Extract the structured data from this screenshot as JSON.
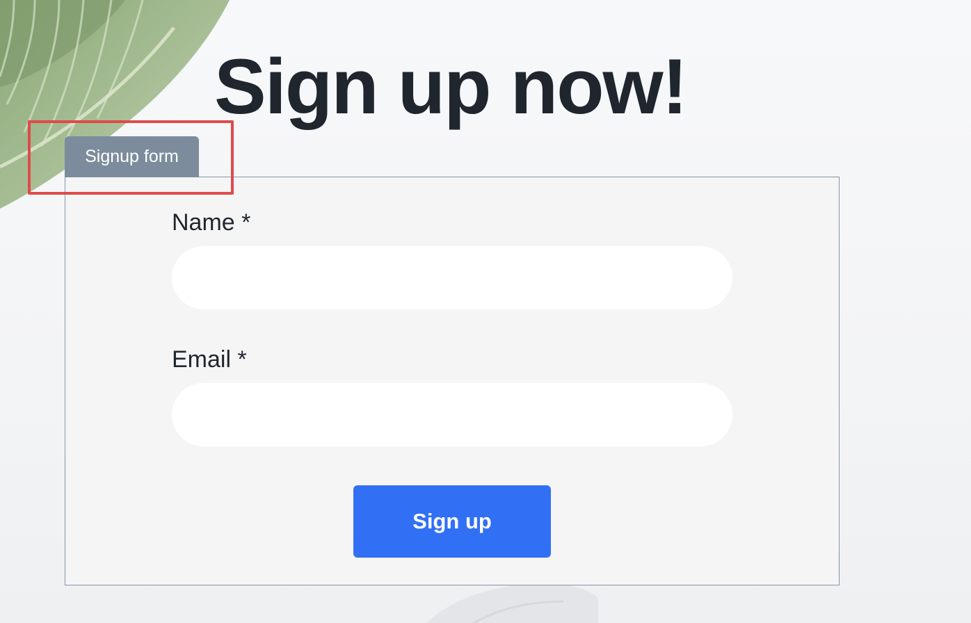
{
  "header": {
    "title": "Sign up now!"
  },
  "form": {
    "tab_label": "Signup form",
    "fields": [
      {
        "label": "Name *",
        "value": "",
        "placeholder": ""
      },
      {
        "label": "Email *",
        "value": "",
        "placeholder": ""
      }
    ],
    "submit_label": "Sign up"
  },
  "colors": {
    "title": "#1f262e",
    "tab_background": "#7c8c9c",
    "panel_background": "#f5f5f5",
    "panel_border": "#8594a8",
    "button_background": "#3170f5",
    "highlight": "#e04a4a"
  },
  "decorations": {
    "background_image": "tropical-leaf"
  }
}
